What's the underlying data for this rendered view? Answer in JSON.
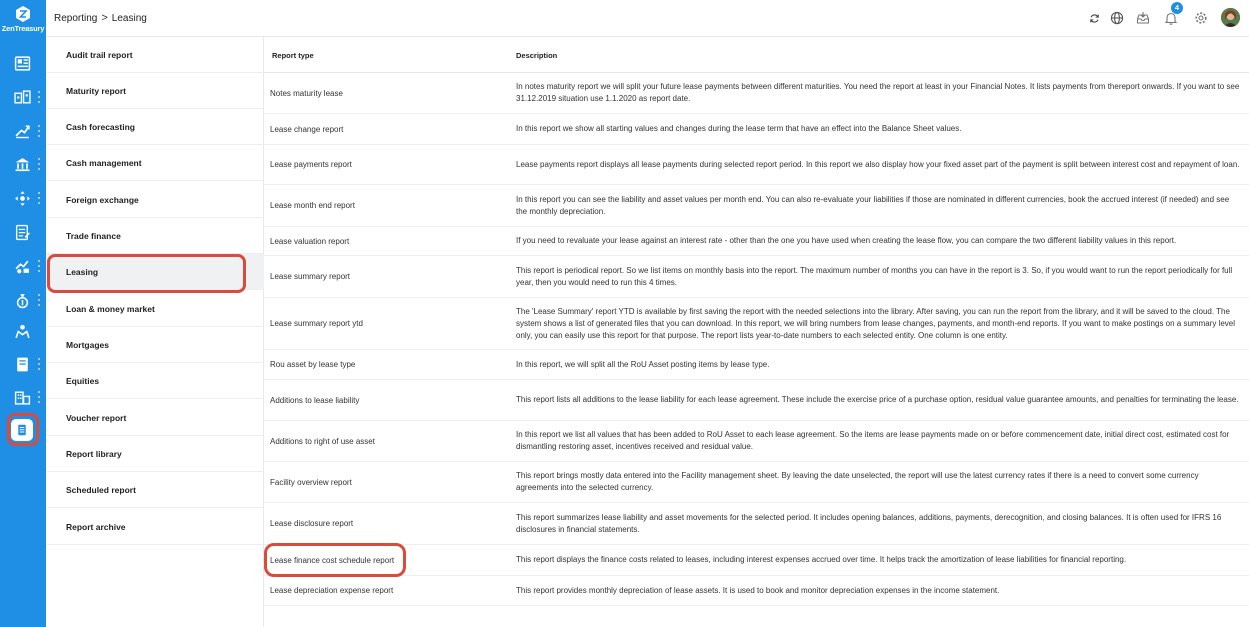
{
  "app": {
    "logo_text": "ZenTreasury"
  },
  "colors": {
    "rail": "#1f8fe6",
    "highlight": "#d94b3a"
  },
  "rail": {
    "items": [
      {
        "icon": "dashboard-icon"
      },
      {
        "icon": "accounts-icon"
      },
      {
        "icon": "forecast-icon"
      },
      {
        "icon": "bank-icon"
      },
      {
        "icon": "transfer-icon"
      },
      {
        "icon": "document-icon"
      },
      {
        "icon": "deals-icon"
      },
      {
        "icon": "money-bag-icon"
      },
      {
        "icon": "governance-icon"
      },
      {
        "icon": "book-icon"
      },
      {
        "icon": "buildings-icon"
      },
      {
        "icon": "reporting-icon"
      }
    ]
  },
  "breadcrumb": {
    "root": "Reporting",
    "separator": ">",
    "current": "Leasing"
  },
  "topbar": {
    "notification_count": "4"
  },
  "menu": {
    "items": [
      "Audit trail report",
      "Maturity report",
      "Cash forecasting",
      "Cash management",
      "Foreign exchange",
      "Trade finance",
      "Leasing",
      "Loan & money market",
      "Mortgages",
      "Equities",
      "Voucher report",
      "Report library",
      "Scheduled report",
      "Report archive"
    ],
    "active": "Leasing"
  },
  "table": {
    "headers": {
      "type": "Report type",
      "description": "Description"
    },
    "rows": [
      {
        "type": "Notes maturity lease",
        "description": "In notes maturity report we will split your future lease payments between different maturities. You need the report at least in your Financial Notes. It lists payments from thereport onwards. If you want to see 31.12.2019 situation use 1.1.2020 as report date."
      },
      {
        "type": "Lease change report",
        "description": "In this report we show all starting values and changes during the lease term that have an effect into the Balance Sheet values."
      },
      {
        "type": "Lease payments report",
        "description": "Lease payments report displays all lease payments during selected report period. In this report we also display how your fixed asset part of the payment is split between interest cost and repayment of loan."
      },
      {
        "type": "Lease month end report",
        "description": "In this report you can see the liability and asset values per month end. You can also re-evaluate your liabilities if those are nominated in different currencies, book the accrued interest (if needed) and see the monthly depreciation."
      },
      {
        "type": "Lease valuation report",
        "description": "If you need to revaluate your lease against an interest rate - other than the one you have used when creating the lease flow, you can compare the two different liability values in this report."
      },
      {
        "type": "Lease summary report",
        "description": "This report is periodical report. So we list items on monthly basis into the report. The maximum number of months you can have in the report is 3. So, if you would want to run the report periodically for full year, then you would need to run this 4 times."
      },
      {
        "type": "Lease summary report ytd",
        "description": "The 'Lease Summary' report YTD is available by first saving the report with the needed selections into the library. After saving, you can run the report from the library, and it will be saved to the cloud. The system shows a list of generated files that you can download. In this report, we will bring numbers from lease changes, payments, and month-end reports. If you want to make postings on a summary level only, you can easily use this report for that purpose. The report lists year-to-date numbers to each selected entity. One column is one entity."
      },
      {
        "type": "Rou asset by lease type",
        "description": "In this report, we will split all the RoU Asset posting items by lease type."
      },
      {
        "type": "Additions to lease liability",
        "description": "This report lists all additions to the lease liability for each lease agreement. These include the exercise price of a purchase option, residual value guarantee amounts, and penalties for terminating the lease."
      },
      {
        "type": "Additions to right of use asset",
        "description": "In this report we list all values that has been added to RoU Asset to each lease agreement. So the items are lease payments made on or before commencement date, initial direct cost, estimated cost for dismantling restoring asset, incentives received and residual value."
      },
      {
        "type": "Facility overview report",
        "description": "This report brings mostly data entered into the Facility management sheet. By leaving the date unselected, the report will use the latest currency rates if there is a need to convert some currency agreements into the selected currency."
      },
      {
        "type": "Lease disclosure report",
        "description": "This report summarizes lease liability and asset movements for the selected period. It includes opening balances, additions, payments, derecognition, and closing balances. It is often used for IFRS 16 disclosures in financial statements."
      },
      {
        "type": "Lease finance cost schedule report",
        "description": "This report displays the finance costs related to leases, including interest expenses accrued over time. It helps track the amortization of lease liabilities for financial reporting."
      },
      {
        "type": "Lease depreciation expense report",
        "description": "This report provides monthly depreciation of lease assets. It is used to book and monitor depreciation expenses in the income statement."
      }
    ]
  }
}
